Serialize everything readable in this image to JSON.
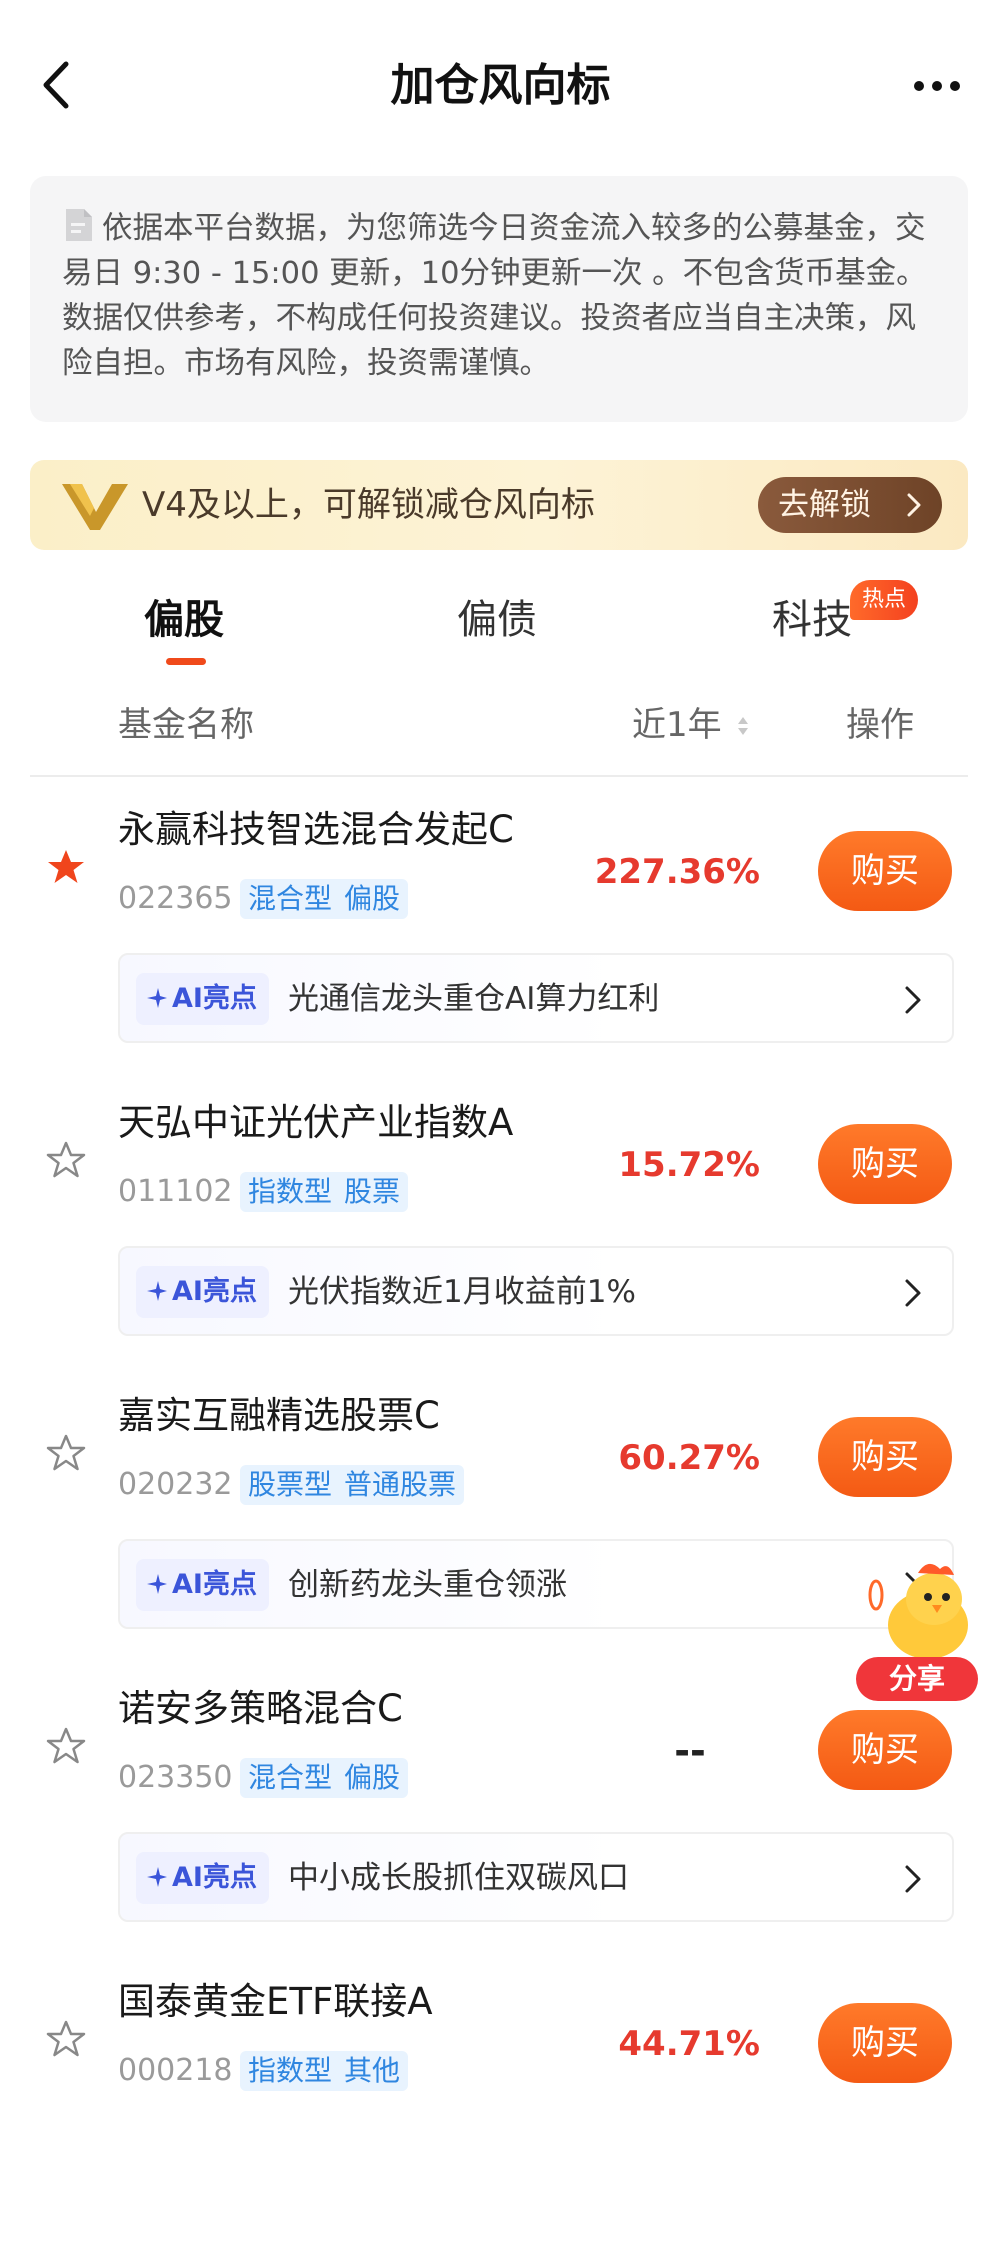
{
  "header": {
    "title": "加仓风向标"
  },
  "notice": {
    "text": "依据本平台数据，为您筛选今日资金流入较多的公募基金，交易日 9:30 - 15:00 更新，10分钟更新一次 。不包含货币基金。数据仅供参考，不构成任何投资建议。投资者应当自主决策，风险自担。市场有风险，投资需谨慎。"
  },
  "vip_banner": {
    "text": "V4及以上，可解锁减仓风向标",
    "button_label": "去解锁"
  },
  "tabs": [
    {
      "label": "偏股",
      "active": true
    },
    {
      "label": "偏债",
      "active": false
    },
    {
      "label": "科技",
      "active": false,
      "badge": "热点"
    }
  ],
  "columns": {
    "name": "基金名称",
    "return": "近1年",
    "action": "操作"
  },
  "funds": [
    {
      "name": "永赢科技智选混合发起C",
      "code": "022365",
      "tags": [
        "混合型",
        "偏股"
      ],
      "return_1y": "227.36%",
      "starred": true,
      "buy_label": "购买",
      "ai_label": "AI亮点",
      "ai_text": "光通信龙头重仓AI算力红利"
    },
    {
      "name": "天弘中证光伏产业指数A",
      "code": "011102",
      "tags": [
        "指数型",
        "股票"
      ],
      "return_1y": "15.72%",
      "starred": false,
      "buy_label": "购买",
      "ai_label": "AI亮点",
      "ai_text": "光伏指数近1月收益前1%"
    },
    {
      "name": "嘉实互融精选股票C",
      "code": "020232",
      "tags": [
        "股票型",
        "普通股票"
      ],
      "return_1y": "60.27%",
      "starred": false,
      "buy_label": "购买",
      "ai_label": "AI亮点",
      "ai_text": "创新药龙头重仓领涨"
    },
    {
      "name": "诺安多策略混合C",
      "code": "023350",
      "tags": [
        "混合型",
        "偏股"
      ],
      "return_1y": "--",
      "starred": false,
      "buy_label": "购买",
      "ai_label": "AI亮点",
      "ai_text": "中小成长股抓住双碳风口"
    },
    {
      "name": "国泰黄金ETF联接A",
      "code": "000218",
      "tags": [
        "指数型",
        "其他"
      ],
      "return_1y": "44.71%",
      "starred": false,
      "buy_label": "购买",
      "ai_label": "",
      "ai_text": ""
    }
  ],
  "share": {
    "label": "分享"
  },
  "colors": {
    "accent_orange": "#f45a14",
    "return_red": "#e63a2e",
    "tag_blue": "#2f86e0",
    "star_filled": "#f0451c"
  }
}
